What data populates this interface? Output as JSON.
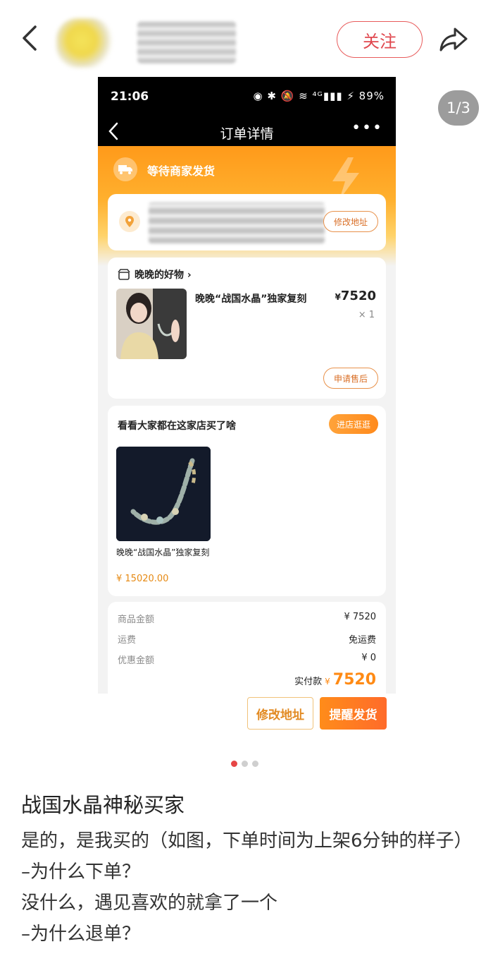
{
  "header": {
    "follow_label": "关注",
    "page_indicator": "1/3"
  },
  "screenshot": {
    "status_bar": {
      "time": "21:06",
      "icons": "◉ ✱ 🔕 ≋ ⁴ᴳ▮▮▮ ⚡ 89%",
      "battery": "89%"
    },
    "nav": {
      "title": "订单详情",
      "more": "•••"
    },
    "order_status": "等待商家发货",
    "address_edit_label": "修改地址",
    "shop_name": "晚晚的好物 ›",
    "product": {
      "name": "晚晚“战国水晶”独家复刻",
      "currency": "¥",
      "price": "7520",
      "qty": "× 1"
    },
    "after_sale_label": "申请售后",
    "recommend": {
      "title": "看看大家都在这家店买了啥",
      "shop_button": "进店逛逛",
      "item_name": "晚晚“战国水晶”独家复刻",
      "item_price": "¥ 15020.00"
    },
    "summary": {
      "rows": [
        {
          "key": "商品金额",
          "value": "¥ 7520"
        },
        {
          "key": "运费",
          "value": "免运费"
        },
        {
          "key": "优惠金额",
          "value": "¥ 0"
        }
      ],
      "paid_label": "实付款",
      "paid_currency": "¥",
      "paid_amount": "7520"
    },
    "actions": {
      "edit_address": "修改地址",
      "remind_ship": "提醒发货"
    }
  },
  "post": {
    "title": "战国水晶神秘买家",
    "lines": [
      "是的，是我买的（如图，下单时间为上架6分钟的样子）",
      "–为什么下单？",
      "没什么，遇见喜欢的就拿了一个",
      "–为什么退单？"
    ]
  },
  "colors": {
    "accent_red": "#e0484f",
    "orange": "#ff8a14"
  }
}
